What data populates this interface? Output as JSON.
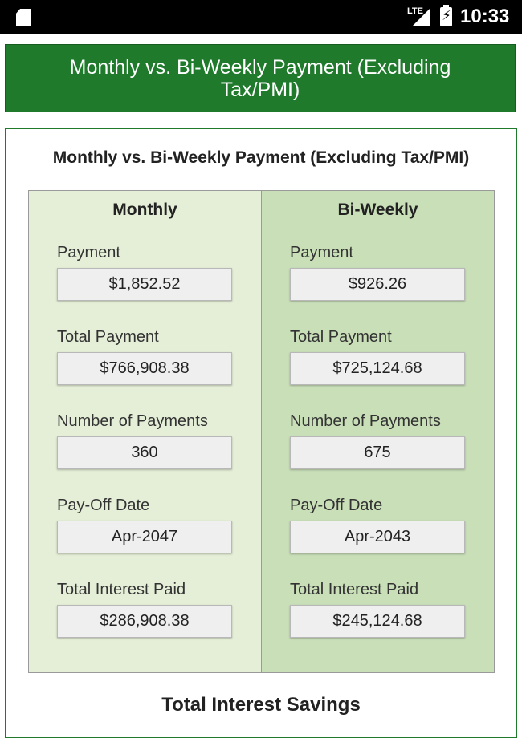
{
  "status_bar": {
    "network_label": "LTE",
    "time": "10:33",
    "icons": [
      "sd-card-icon",
      "signal-icon",
      "battery-charging-icon"
    ]
  },
  "header": {
    "title": "Monthly vs. Bi-Weekly Payment (Excluding Tax/PMI)",
    "background": "#1f7a2c"
  },
  "card": {
    "title": "Monthly vs. Bi-Weekly Payment (Excluding Tax/PMI)",
    "monthly": {
      "heading": "Monthly",
      "payment_label": "Payment",
      "payment_value": "$1,852.52",
      "total_payment_label": "Total Payment",
      "total_payment_value": "$766,908.38",
      "num_payments_label": "Number of Payments",
      "num_payments_value": "360",
      "payoff_label": "Pay-Off Date",
      "payoff_value": "Apr-2047",
      "interest_label": "Total Interest Paid",
      "interest_value": "$286,908.38"
    },
    "biweekly": {
      "heading": "Bi-Weekly",
      "payment_label": "Payment",
      "payment_value": "$926.26",
      "total_payment_label": "Total Payment",
      "total_payment_value": "$725,124.68",
      "num_payments_label": "Number of Payments",
      "num_payments_value": "675",
      "payoff_label": "Pay-Off Date",
      "payoff_value": "Apr-2043",
      "interest_label": "Total Interest Paid",
      "interest_value": "$245,124.68"
    },
    "savings_title": "Total Interest Savings"
  },
  "colors": {
    "monthly_bg": "#e5efd7",
    "biweekly_bg": "#c9dfb8",
    "accent": "#1f7a2c"
  }
}
